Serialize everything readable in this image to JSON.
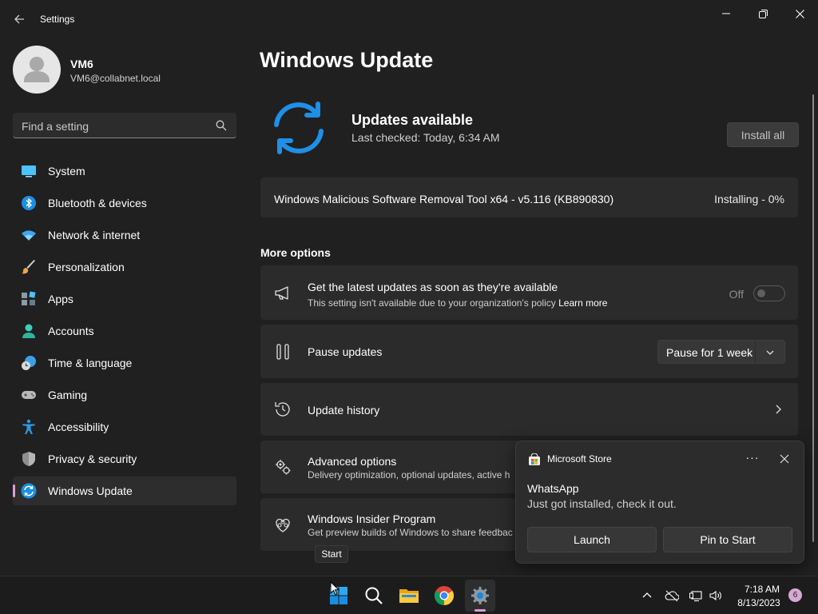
{
  "window": {
    "title": "Settings",
    "controls": [
      "minimize",
      "maximize",
      "close"
    ]
  },
  "user": {
    "name": "VM6",
    "email": "VM6@collabnet.local"
  },
  "search": {
    "placeholder": "Find a setting"
  },
  "sidebar": {
    "items": [
      {
        "label": "System",
        "icon": "system-icon"
      },
      {
        "label": "Bluetooth & devices",
        "icon": "bluetooth-icon"
      },
      {
        "label": "Network & internet",
        "icon": "wifi-icon"
      },
      {
        "label": "Personalization",
        "icon": "brush-icon"
      },
      {
        "label": "Apps",
        "icon": "apps-icon"
      },
      {
        "label": "Accounts",
        "icon": "accounts-icon"
      },
      {
        "label": "Time & language",
        "icon": "clock-globe-icon"
      },
      {
        "label": "Gaming",
        "icon": "gamepad-icon"
      },
      {
        "label": "Accessibility",
        "icon": "accessibility-icon"
      },
      {
        "label": "Privacy & security",
        "icon": "shield-icon"
      },
      {
        "label": "Windows Update",
        "icon": "sync-icon",
        "active": true
      }
    ]
  },
  "main": {
    "title": "Windows Update",
    "status_title": "Updates available",
    "status_sub": "Last checked: Today, 6:34 AM",
    "install_all": "Install all",
    "update": {
      "name": "Windows Malicious Software Removal Tool x64 - v5.116 (KB890830)",
      "status": "Installing - 0%"
    },
    "more_options": "More options",
    "options": {
      "latest": {
        "title": "Get the latest updates as soon as they're available",
        "sub": "This setting isn't available due to your organization's policy",
        "learn_more": "Learn more",
        "toggle_label": "Off"
      },
      "pause": {
        "title": "Pause updates",
        "select_value": "Pause for 1 week"
      },
      "history": {
        "title": "Update history"
      },
      "advanced": {
        "title": "Advanced options",
        "sub": "Delivery optimization, optional updates, active h"
      },
      "insider": {
        "title": "Windows Insider Program",
        "sub": "Get preview builds of Windows to share feedbac"
      }
    }
  },
  "toast": {
    "app": "Microsoft Store",
    "more": "···",
    "title": "WhatsApp",
    "message": "Just got installed, check it out.",
    "launch": "Launch",
    "pin": "Pin to Start"
  },
  "tooltip": "Start",
  "taskbar": {
    "time": "7:18 AM",
    "date": "8/13/2023",
    "notifications": "6",
    "accent": "#d99fd8"
  },
  "colors": {
    "background": "#202020",
    "card": "#2b2b2b",
    "accent_blue": "#1e90e6",
    "accent_pink": "#d99fd8"
  }
}
